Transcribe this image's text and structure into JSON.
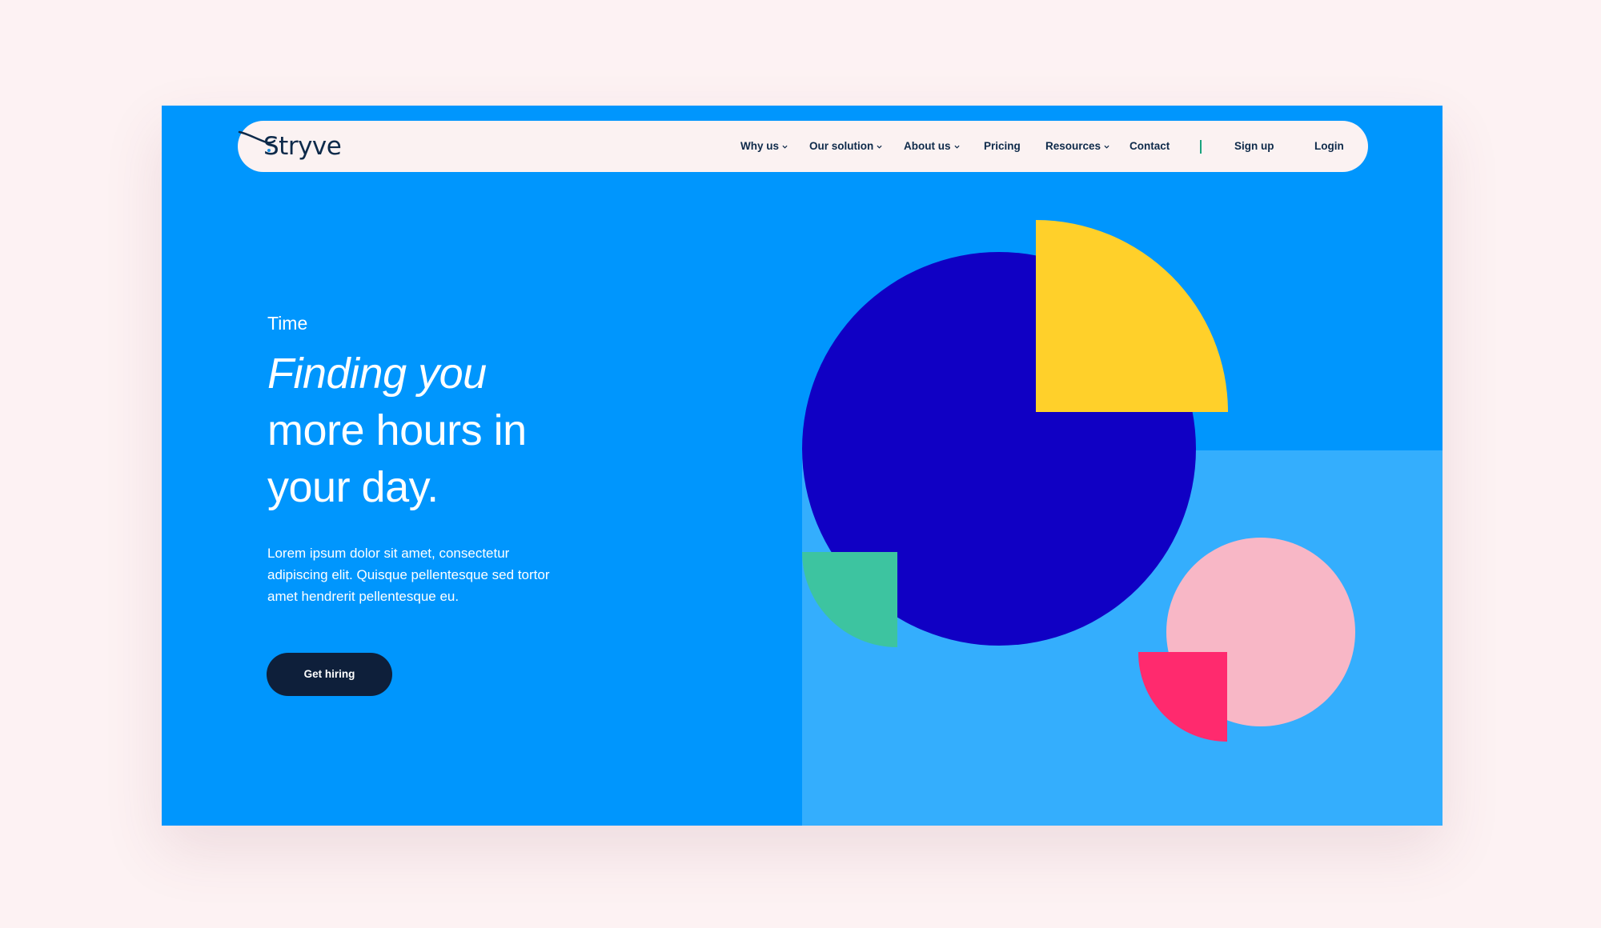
{
  "brand": {
    "name": "Stryve"
  },
  "nav": {
    "items": [
      {
        "label": "Why us",
        "dropdown": true
      },
      {
        "label": "Our solution",
        "dropdown": true
      },
      {
        "label": "About us",
        "dropdown": true
      },
      {
        "label": "Pricing",
        "dropdown": false
      },
      {
        "label": "Resources",
        "dropdown": true
      },
      {
        "label": "Contact",
        "dropdown": false
      }
    ],
    "signup": "Sign up",
    "login": "Login"
  },
  "hero": {
    "eyebrow": "Time",
    "headline_italic": "Finding you",
    "headline_line2": "more hours in",
    "headline_line3": "your day.",
    "body": "Lorem ipsum dolor sit amet, consectetur adipiscing elit. Quisque pellentesque sed tortor amet hendrerit pellentesque eu.",
    "cta_label": "Get hiring"
  },
  "colors": {
    "page_bg": "#fdf2f3",
    "hero_bg": "#0096fd",
    "panel_light": "#34aefd",
    "navy_circle": "#1000c4",
    "yellow": "#ffd02a",
    "teal": "#3dc4a0",
    "pink_light": "#f8b7c6",
    "pink_hot": "#ff2a6e",
    "text_dark": "#0e2a4a",
    "cta_bg": "#0e1f3a"
  }
}
